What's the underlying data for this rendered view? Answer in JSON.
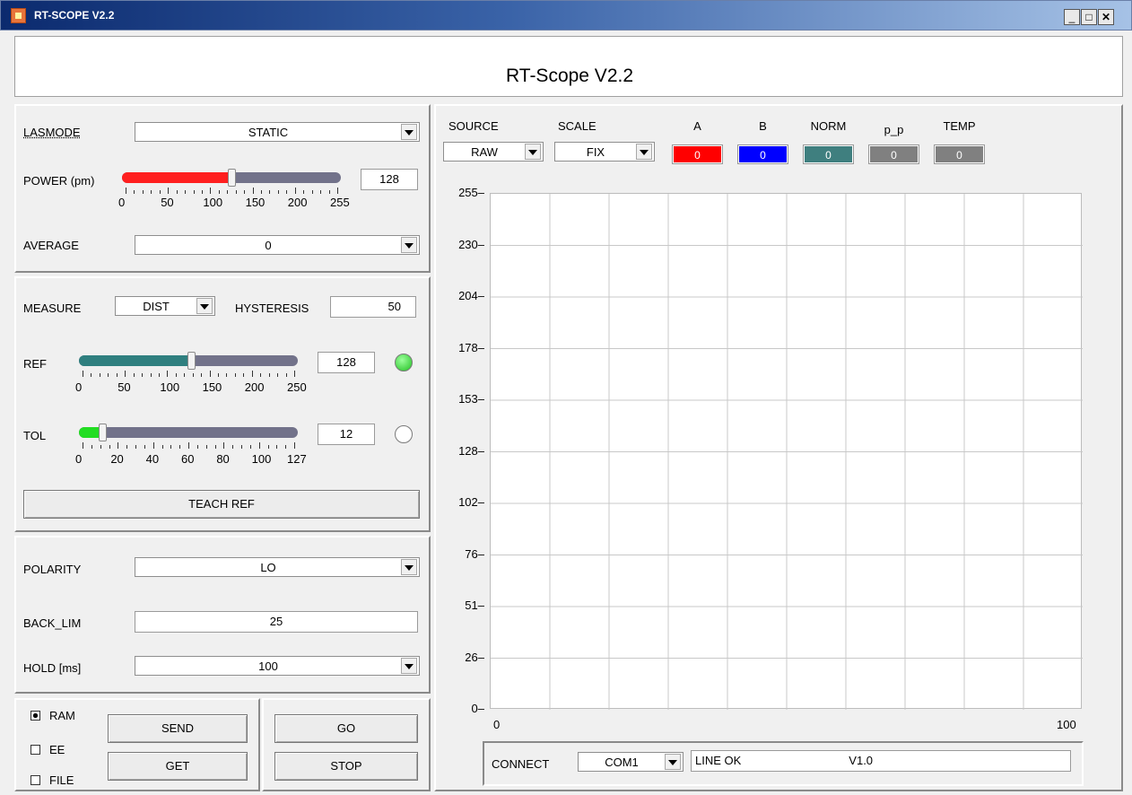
{
  "window": {
    "title": "RT-SCOPE V2.2",
    "app_title": "RT-Scope V2.2"
  },
  "laser": {
    "lasmode_label": "LASMODE",
    "lasmode_value": "STATIC",
    "power_label": "POWER (pm)",
    "power_value": "128",
    "power_ticks": [
      "0",
      "50",
      "100",
      "150",
      "200",
      "255"
    ],
    "power_level": 0.502,
    "average_label": "AVERAGE",
    "average_value": "0"
  },
  "measure": {
    "measure_label": "MEASURE",
    "measure_value": "DIST",
    "hysteresis_label": "HYSTERESIS",
    "hysteresis_value": "50",
    "ref_label": "REF",
    "ref_value": "128",
    "ref_ticks": [
      "0",
      "50",
      "100",
      "150",
      "200",
      "250"
    ],
    "ref_level": 0.512,
    "ref_led_color": "#22c022",
    "tol_label": "TOL",
    "tol_value": "12",
    "tol_ticks": [
      "0",
      "20",
      "40",
      "60",
      "80",
      "100",
      "127"
    ],
    "tol_level": 0.094,
    "tol_led_color": "#ffffff",
    "teach_label": "TEACH REF"
  },
  "output": {
    "polarity_label": "POLARITY",
    "polarity_value": "LO",
    "backlim_label": "BACK_LIM",
    "backlim_value": "25",
    "hold_label": "HOLD [ms]",
    "hold_value": "100"
  },
  "memory": {
    "ram_label": "RAM",
    "ee_label": "EE",
    "file_label": "FILE",
    "ram_checked": true,
    "send_label": "SEND",
    "get_label": "GET",
    "go_label": "GO",
    "stop_label": "STOP"
  },
  "scope": {
    "source_label": "SOURCE",
    "source_value": "RAW",
    "scale_label": "SCALE",
    "scale_value": "FIX",
    "indicators": [
      {
        "label": "A",
        "value": "0",
        "color": "#ff0000"
      },
      {
        "label": "B",
        "value": "0",
        "color": "#0000ff"
      },
      {
        "label": "NORM",
        "value": "0",
        "color": "#3f7f7f"
      },
      {
        "label": "p_p",
        "value": "0",
        "color": "#808080"
      },
      {
        "label": "TEMP",
        "value": "0",
        "color": "#808080"
      }
    ]
  },
  "chart_data": {
    "type": "line",
    "xlim": [
      0,
      100
    ],
    "ylim": [
      0,
      255
    ],
    "x_ticks": [
      "0",
      "100"
    ],
    "y_ticks": [
      "255",
      "230",
      "204",
      "178",
      "153",
      "128",
      "102",
      "76",
      "51",
      "26",
      "0"
    ],
    "grid": true,
    "series": []
  },
  "connect": {
    "label": "CONNECT",
    "port": "COM1",
    "status": "LINE OK",
    "version": "V1.0"
  }
}
